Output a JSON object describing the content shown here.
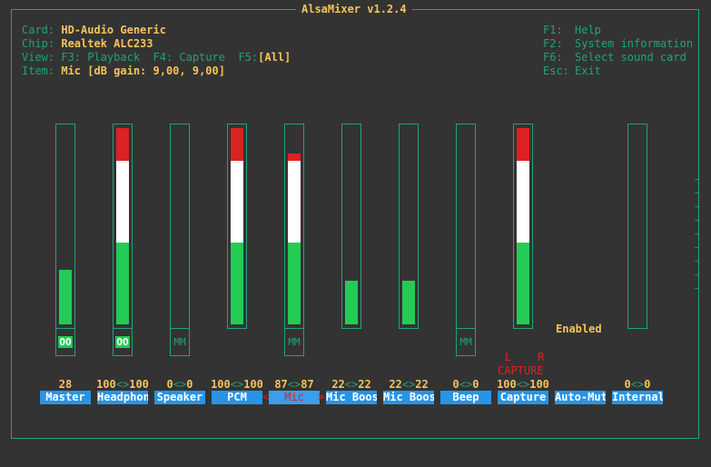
{
  "title": "AlsaMixer v1.2.4",
  "info": {
    "card_label": "Card:",
    "card": "HD-Audio Generic",
    "chip_label": "Chip:",
    "chip": "Realtek ALC233",
    "view_label": "View:",
    "view_playback": "F3: Playback",
    "view_capture": "F4: Capture",
    "view_f5": "F5:",
    "view_all": "[All]",
    "item_label": "Item:",
    "item": "Mic [dB gain: 9,00, 9,00]"
  },
  "help": [
    {
      "key": "F1:",
      "text": "Help"
    },
    {
      "key": "F2:",
      "text": "System information"
    },
    {
      "key": "F6:",
      "text": "Select sound card"
    },
    {
      "key": "Esc:",
      "text": "Exit"
    }
  ],
  "channels": [
    {
      "name": "Master",
      "value_left": "28",
      "value_right": "",
      "level": 0.28,
      "switch": "OO",
      "switch_on": true
    },
    {
      "name": "Headphon",
      "value_left": "100",
      "value_right": "100",
      "level": 1.0,
      "switch": "OO",
      "switch_on": true
    },
    {
      "name": "Speaker",
      "value_left": "0",
      "value_right": "0",
      "level": 0,
      "switch": "MM",
      "switch_on": false
    },
    {
      "name": "PCM",
      "value_left": "100",
      "value_right": "100",
      "level": 1.0,
      "switch": "",
      "switch_on": false
    },
    {
      "name": "Mic",
      "value_left": "87",
      "value_right": "87",
      "level": 0.87,
      "switch": "MM",
      "switch_on": false,
      "selected": true
    },
    {
      "name": "Mic Boos",
      "value_left": "22",
      "value_right": "22",
      "level": 0.22,
      "switch": "",
      "switch_on": false
    },
    {
      "name": "Mic Boos",
      "value_left": "22",
      "value_right": "22",
      "level": 0.22,
      "switch": "",
      "switch_on": false
    },
    {
      "name": "Beep",
      "value_left": "0",
      "value_right": "0",
      "level": 0,
      "switch": "MM",
      "switch_on": false
    },
    {
      "name": "Capture",
      "value_left": "100",
      "value_right": "100",
      "level": 1.0,
      "switch": "",
      "switch_on": false
    },
    {
      "name": "Auto-Mut",
      "value_left": "",
      "value_right": "",
      "level": null,
      "switch": "",
      "switch_on": false
    },
    {
      "name": "Internal",
      "value_left": "0",
      "value_right": "0",
      "level": 0,
      "switch": "",
      "switch_on": false
    }
  ],
  "auto_mute_value": "Enabled",
  "capture_lr": "L    R",
  "capture_label": "CAPTURE",
  "value_separator": "<>",
  "select_left": "<",
  "select_right": ">",
  "scroll_arrows": [
    "→",
    "→",
    "→",
    "→",
    "→",
    "→",
    "→",
    "→",
    "→"
  ],
  "colors": {
    "accent": "#1fa37a",
    "value": "#f5c45a",
    "label_bg": "#2794e8",
    "high": "#dd2222",
    "mid": "#ffffff",
    "low": "#22cc55"
  }
}
